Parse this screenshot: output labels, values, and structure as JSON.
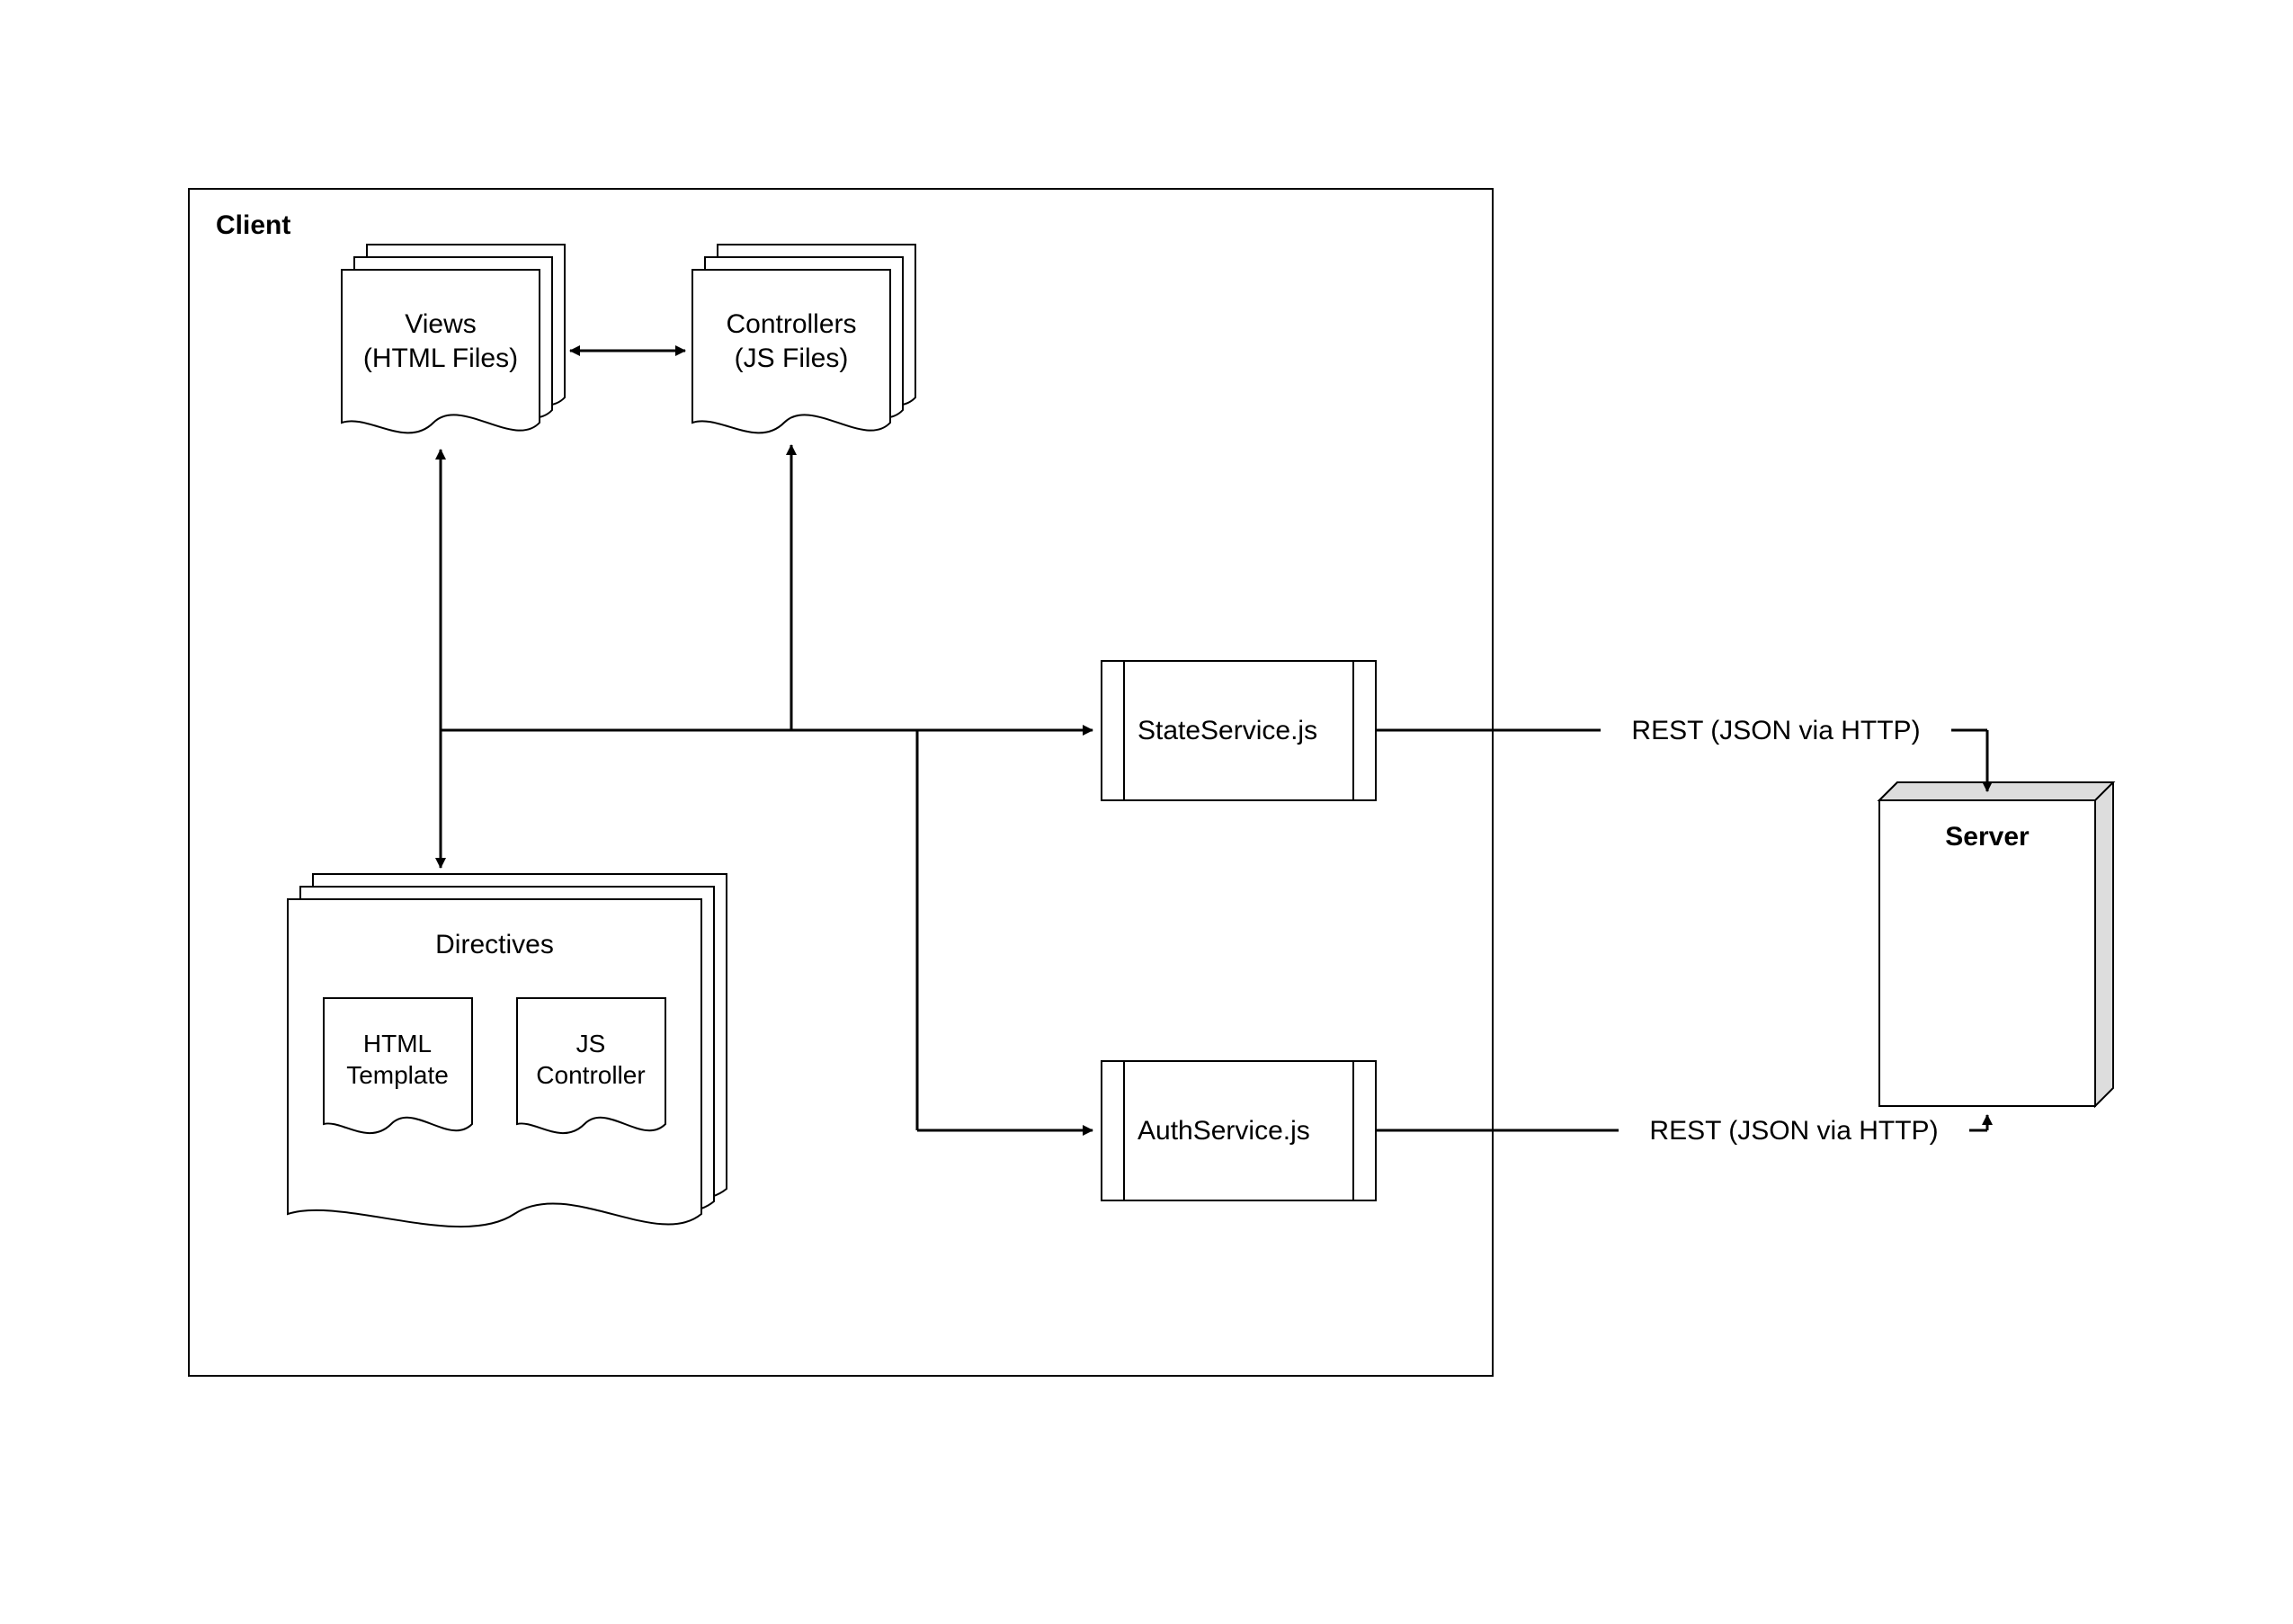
{
  "client": {
    "title": "Client"
  },
  "views": {
    "label_line1": "Views",
    "label_line2": "(HTML Files)"
  },
  "controllers": {
    "label_line1": "Controllers",
    "label_line2": "(JS Files)"
  },
  "directives": {
    "title": "Directives",
    "html_template": {
      "line1": "HTML",
      "line2": "Template"
    },
    "js_controller": {
      "line1": "JS",
      "line2": "Controller"
    }
  },
  "services": {
    "state": "StateService.js",
    "auth": "AuthService.js"
  },
  "server": {
    "title": "Server"
  },
  "edges": {
    "rest1": "REST (JSON via HTTP)",
    "rest2": "REST (JSON via HTTP)"
  }
}
